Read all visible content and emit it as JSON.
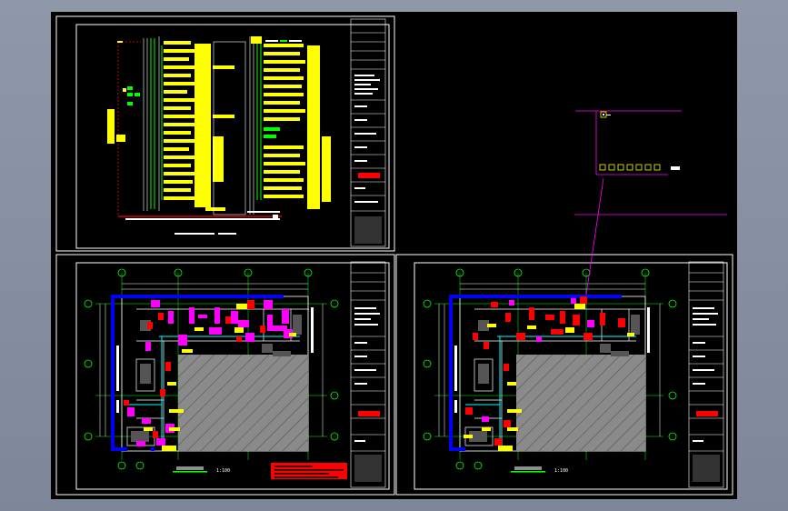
{
  "colors": {
    "background": "#8e98a9",
    "model_space": "#000000",
    "frame": "#ffffff",
    "wiring_yellow": "#ffff00",
    "wiring_green": "#00ff00",
    "wall_blue": "#0000ff",
    "device_magenta": "#ff00ff",
    "device_red": "#ff0000",
    "hatch_gray": "#808080",
    "leader_magenta": "#ff00ff"
  },
  "sheets": [
    {
      "id": "riser",
      "title": "",
      "scale": ""
    },
    {
      "id": "plan-1",
      "title": "",
      "scale": "1:100"
    },
    {
      "id": "plan-2",
      "title": "",
      "scale": "1:100"
    }
  ],
  "detail": {
    "id": "enlarged-detail"
  }
}
